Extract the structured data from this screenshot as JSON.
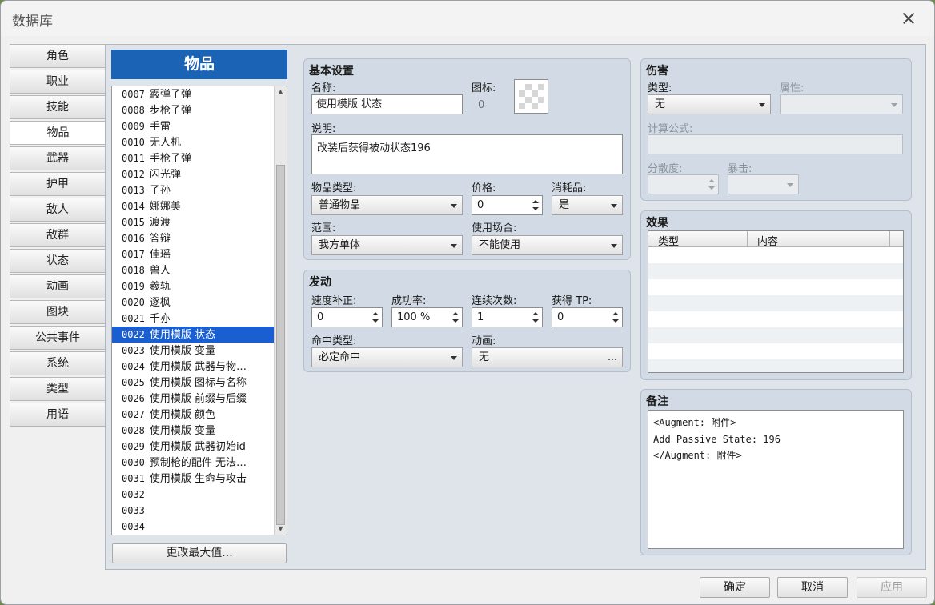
{
  "window": {
    "title": "数据库"
  },
  "tabs": [
    "角色",
    "职业",
    "技能",
    "物品",
    "武器",
    "护甲",
    "敌人",
    "敌群",
    "状态",
    "动画",
    "图块",
    "公共事件",
    "系统",
    "类型",
    "用语"
  ],
  "active_tab": "物品",
  "list": {
    "header": "物品",
    "items": [
      {
        "id": "0007",
        "name": "霰弹子弹"
      },
      {
        "id": "0008",
        "name": "步枪子弹"
      },
      {
        "id": "0009",
        "name": "手雷"
      },
      {
        "id": "0010",
        "name": "无人机"
      },
      {
        "id": "0011",
        "name": "手枪子弹"
      },
      {
        "id": "0012",
        "name": "闪光弹"
      },
      {
        "id": "0013",
        "name": "子孙"
      },
      {
        "id": "0014",
        "name": "娜娜美"
      },
      {
        "id": "0015",
        "name": "渡渡"
      },
      {
        "id": "0016",
        "name": "答辩"
      },
      {
        "id": "0017",
        "name": "佳瑶"
      },
      {
        "id": "0018",
        "name": "兽人"
      },
      {
        "id": "0019",
        "name": "羲轨"
      },
      {
        "id": "0020",
        "name": "逐枫"
      },
      {
        "id": "0021",
        "name": "千亦"
      },
      {
        "id": "0022",
        "name": "使用模版 状态"
      },
      {
        "id": "0023",
        "name": "使用模版 变量"
      },
      {
        "id": "0024",
        "name": "使用模版 武器与物…"
      },
      {
        "id": "0025",
        "name": "使用模版 图标与名称"
      },
      {
        "id": "0026",
        "name": "使用模版 前缀与后缀"
      },
      {
        "id": "0027",
        "name": "使用模版 颜色"
      },
      {
        "id": "0028",
        "name": "使用模版 变量"
      },
      {
        "id": "0029",
        "name": "使用模版 武器初始id"
      },
      {
        "id": "0030",
        "name": "预制枪的配件 无法…"
      },
      {
        "id": "0031",
        "name": "使用模版 生命与攻击"
      },
      {
        "id": "0032",
        "name": ""
      },
      {
        "id": "0033",
        "name": ""
      },
      {
        "id": "0034",
        "name": ""
      }
    ],
    "selected_id": "0022",
    "change_max_label": "更改最大值..."
  },
  "basic": {
    "title": "基本设置",
    "name_label": "名称:",
    "name_value": "使用模版 状态",
    "icon_label": "图标:",
    "icon_index": "0",
    "desc_label": "说明:",
    "desc_value": "改装后获得被动状态196",
    "item_type_label": "物品类型:",
    "item_type_value": "普通物品",
    "price_label": "价格:",
    "price_value": "0",
    "consumable_label": "消耗品:",
    "consumable_value": "是",
    "scope_label": "范围:",
    "scope_value": "我方单体",
    "occasion_label": "使用场合:",
    "occasion_value": "不能使用"
  },
  "invocation": {
    "title": "发动",
    "speed_label": "速度补正:",
    "speed_value": "0",
    "success_label": "成功率:",
    "success_value": "100 %",
    "repeats_label": "连续次数:",
    "repeats_value": "1",
    "tp_label": "获得 TP:",
    "tp_value": "0",
    "hit_type_label": "命中类型:",
    "hit_type_value": "必定命中",
    "animation_label": "动画:",
    "animation_value": "无"
  },
  "damage": {
    "title": "伤害",
    "type_label": "类型:",
    "type_value": "无",
    "element_label": "属性:",
    "formula_label": "计算公式:",
    "variance_label": "分散度:",
    "critical_label": "暴击:"
  },
  "effects": {
    "title": "效果",
    "col_type": "类型",
    "col_content": "内容"
  },
  "note": {
    "title": "备注",
    "lines": [
      "<Augment: 附件>",
      "Add Passive State: 196",
      "</Augment: 附件>"
    ]
  },
  "footer": {
    "ok": "确定",
    "cancel": "取消",
    "apply": "应用"
  }
}
